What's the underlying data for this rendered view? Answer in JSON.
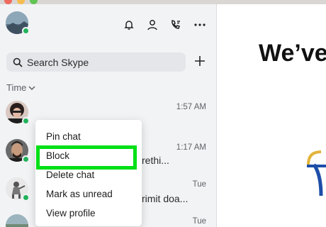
{
  "header": {
    "search_placeholder": "Search Skype"
  },
  "sort": {
    "label": "Time"
  },
  "conversations": [
    {
      "time": "1:57 AM",
      "snippet": ""
    },
    {
      "time": "1:17 AM",
      "snippet": "rethi..."
    },
    {
      "time": "Tue",
      "snippet": "rimit doa..."
    },
    {
      "time": "Tue",
      "snippet": ""
    }
  ],
  "context_menu": {
    "items": [
      "Pin chat",
      "Block",
      "Delete chat",
      "Mark as unread",
      "View profile"
    ],
    "highlighted": "Block",
    "highlight_color": "#00e016"
  },
  "main": {
    "headline": "We’ve"
  },
  "colors": {
    "presence": "#21b35b",
    "sidebar_bg": "#f2f3f5"
  },
  "icons": [
    "bell-icon",
    "person-icon",
    "phone-icon",
    "more-icon",
    "search-icon",
    "plus-icon",
    "chevron-down-icon"
  ]
}
